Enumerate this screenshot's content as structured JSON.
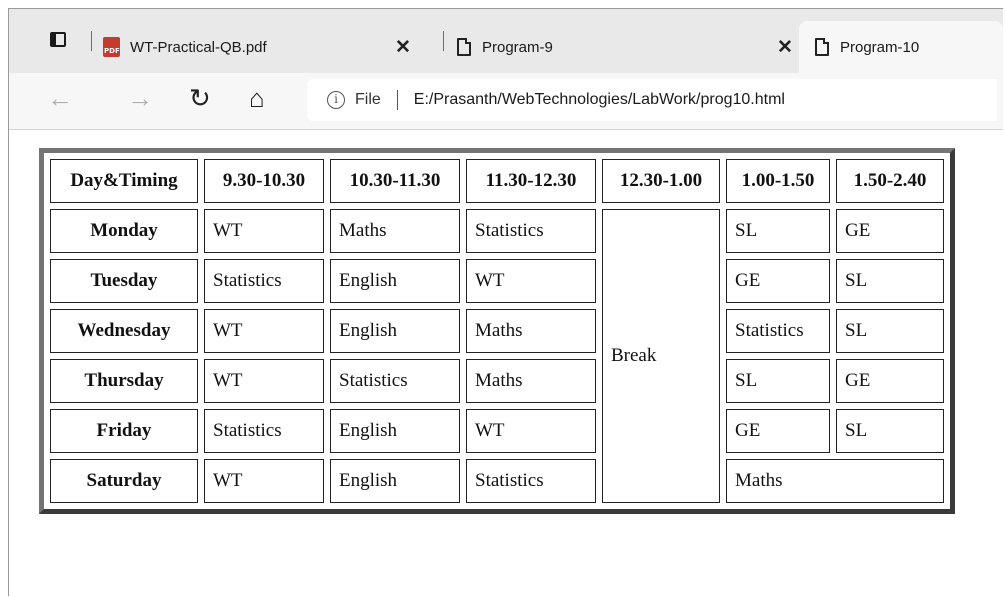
{
  "tabs": [
    {
      "label": "WT-Practical-QB.pdf",
      "icon": "pdf-file-icon"
    },
    {
      "label": "Program-9",
      "icon": "page-icon"
    },
    {
      "label": "Program-10",
      "icon": "page-icon",
      "active": true
    }
  ],
  "toolbar": {
    "back_icon": "←",
    "forward_icon": "→",
    "reload_icon": "↻",
    "home_icon": "⌂",
    "info_icon": "i",
    "file_label": "File",
    "url": "E:/Prasanth/WebTechnologies/LabWork/prog10.html"
  },
  "timetable": {
    "headers": [
      "Day&Timing",
      "9.30-10.30",
      "10.30-11.30",
      "11.30-12.30",
      "12.30-1.00",
      "1.00-1.50",
      "1.50-2.40"
    ],
    "break_label": "Break",
    "rows": [
      {
        "day": "Monday",
        "s1": "WT",
        "s2": "Maths",
        "s3": "Statistics",
        "s5": "SL",
        "s6": "GE"
      },
      {
        "day": "Tuesday",
        "s1": "Statistics",
        "s2": "English",
        "s3": "WT",
        "s5": "GE",
        "s6": "SL"
      },
      {
        "day": "Wednesday",
        "s1": "WT",
        "s2": "English",
        "s3": "Maths",
        "s5": "Statistics",
        "s6": "SL"
      },
      {
        "day": "Thursday",
        "s1": "WT",
        "s2": "Statistics",
        "s3": "Maths",
        "s5": "SL",
        "s6": "GE"
      },
      {
        "day": "Friday",
        "s1": "Statistics",
        "s2": "English",
        "s3": "WT",
        "s5": "GE",
        "s6": "SL"
      },
      {
        "day": "Saturday",
        "s1": "WT",
        "s2": "English",
        "s3": "Statistics",
        "s56": "Maths"
      }
    ]
  }
}
